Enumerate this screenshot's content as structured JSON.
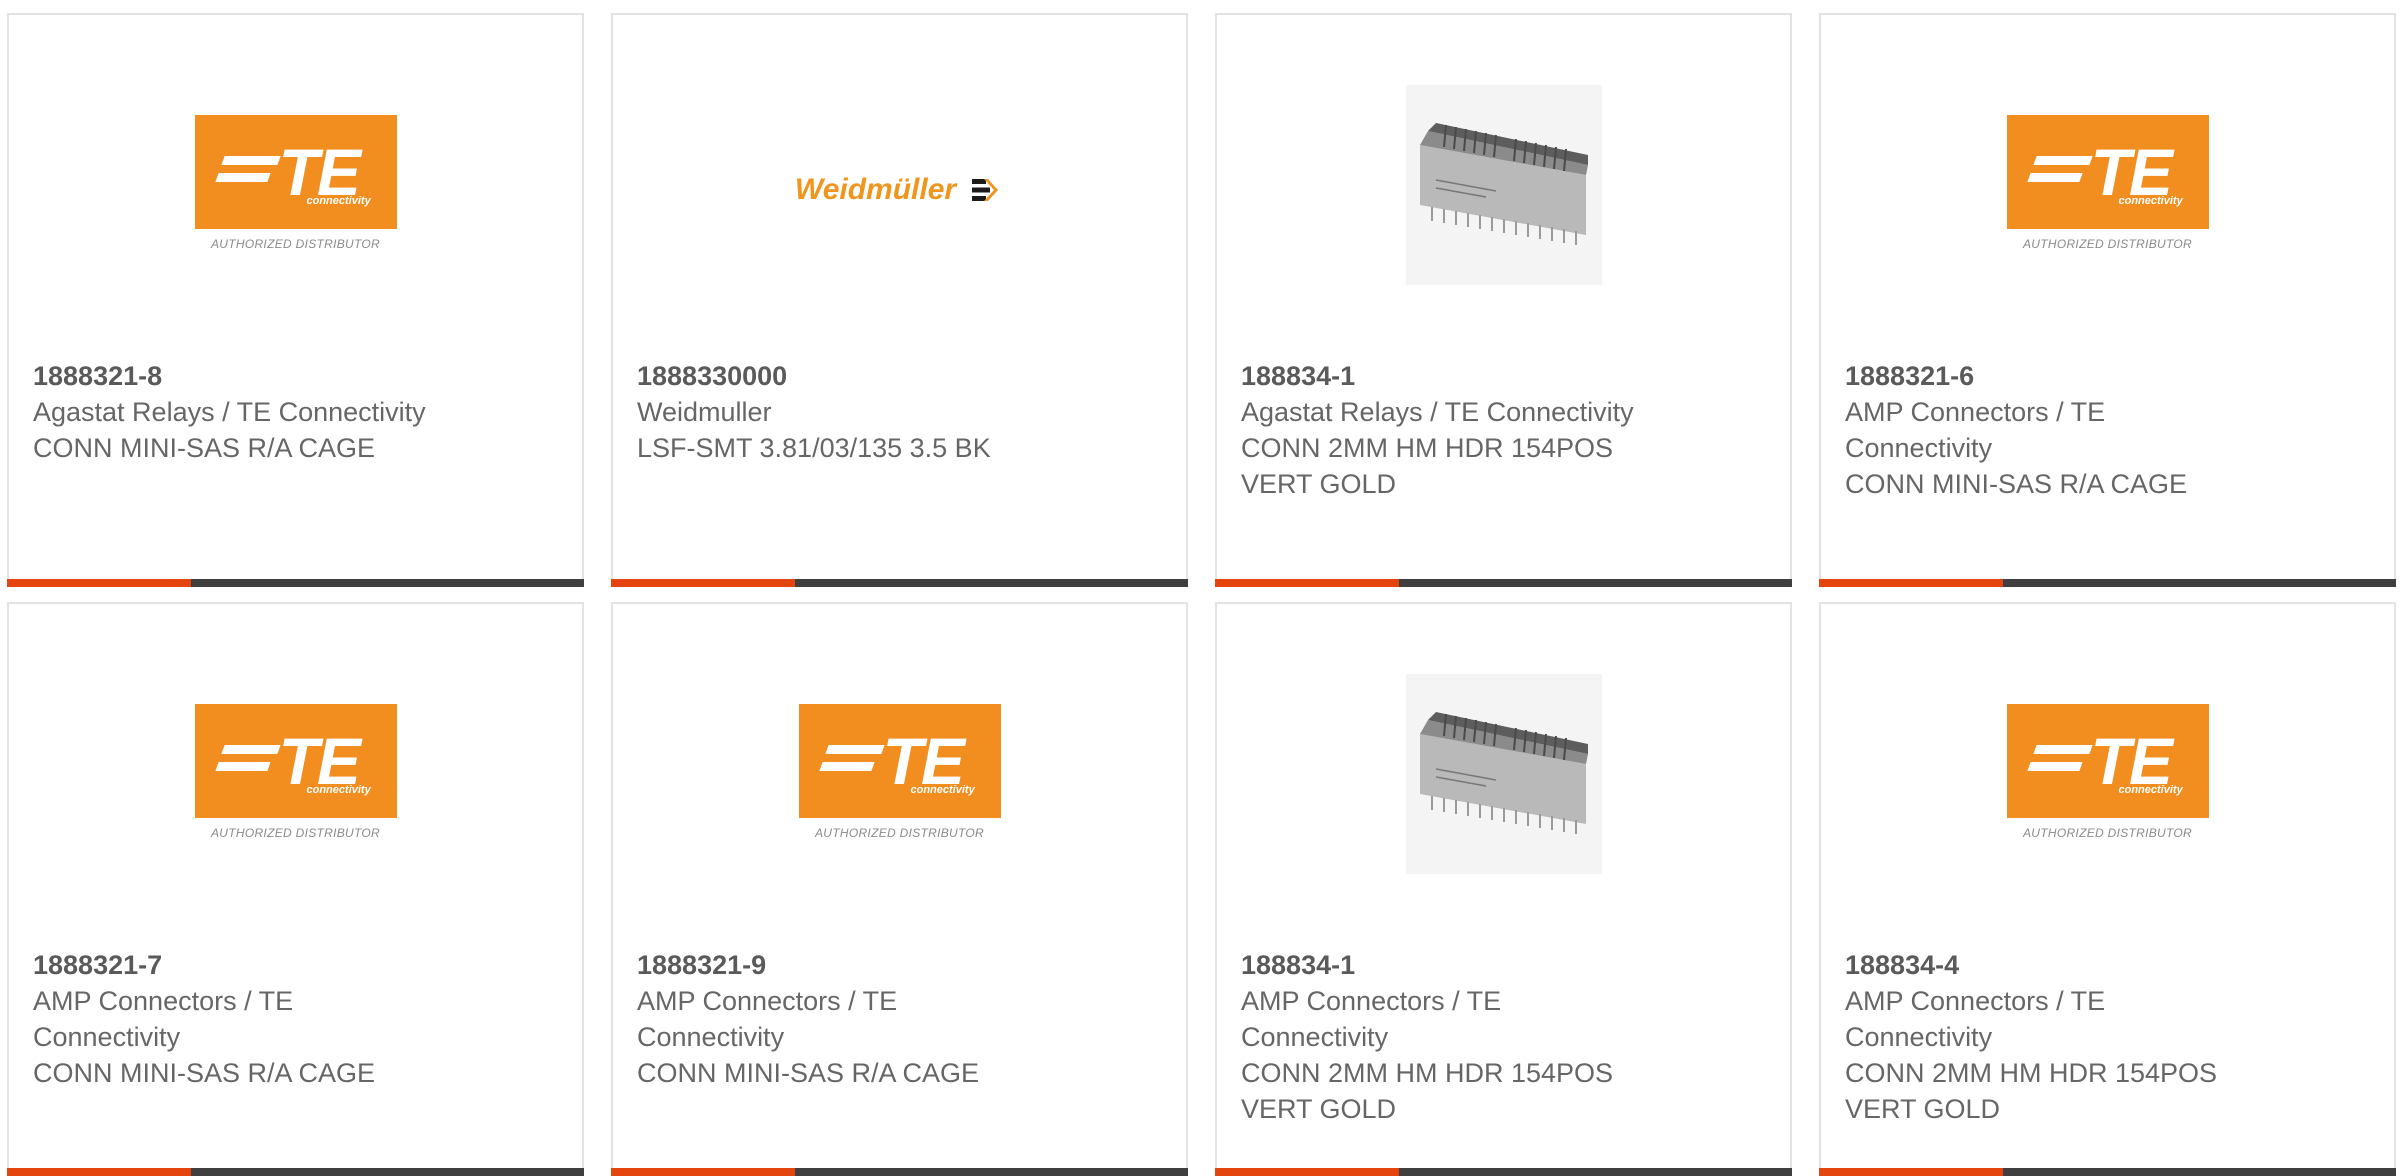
{
  "cards": [
    {
      "part": "1888321-8",
      "mfr": "Agastat Relays / TE Connectivity",
      "desc": "CONN MINI-SAS R/A CAGE",
      "image": "te-authorized-distributor-logo"
    },
    {
      "part": "1888330000",
      "mfr": "Weidmuller",
      "desc": "LSF-SMT 3.81/03/135 3.5 BK",
      "image": "weidmuller-logo"
    },
    {
      "part": "188834-1",
      "mfr": "Agastat Relays / TE Connectivity",
      "desc": "CONN 2MM HM HDR 154POS VERT GOLD",
      "image": "connector-header-photo"
    },
    {
      "part": "1888321-6",
      "mfr": "AMP Connectors / TE Connectivity",
      "desc": "CONN MINI-SAS R/A CAGE",
      "image": "te-authorized-distributor-logo"
    },
    {
      "part": "1888321-7",
      "mfr": "AMP Connectors / TE Connectivity",
      "desc": "CONN MINI-SAS R/A CAGE",
      "image": "te-authorized-distributor-logo"
    },
    {
      "part": "1888321-9",
      "mfr": "AMP Connectors / TE Connectivity",
      "desc": "CONN MINI-SAS R/A CAGE",
      "image": "te-authorized-distributor-logo"
    },
    {
      "part": "188834-1",
      "mfr": "AMP Connectors / TE Connectivity",
      "desc": "CONN 2MM HM HDR 154POS VERT GOLD",
      "image": "connector-header-photo"
    },
    {
      "part": "188834-4",
      "mfr": "AMP Connectors / TE Connectivity",
      "desc": "CONN 2MM HM HDR 154POS VERT GOLD",
      "image": "connector-header-photo"
    }
  ],
  "logos": {
    "te": {
      "wordmark": "TE",
      "tagline": "connectivity",
      "caption": "AUTHORIZED DISTRIBUTOR"
    },
    "weidmuller": {
      "wordmark": "Weidmüller"
    }
  },
  "colors": {
    "accent_bar": "#e4450f",
    "dark_bar": "#3f3f3f",
    "te_orange": "#f28e1f",
    "weidmuller_orange": "#f0961e",
    "text": "#666666"
  }
}
